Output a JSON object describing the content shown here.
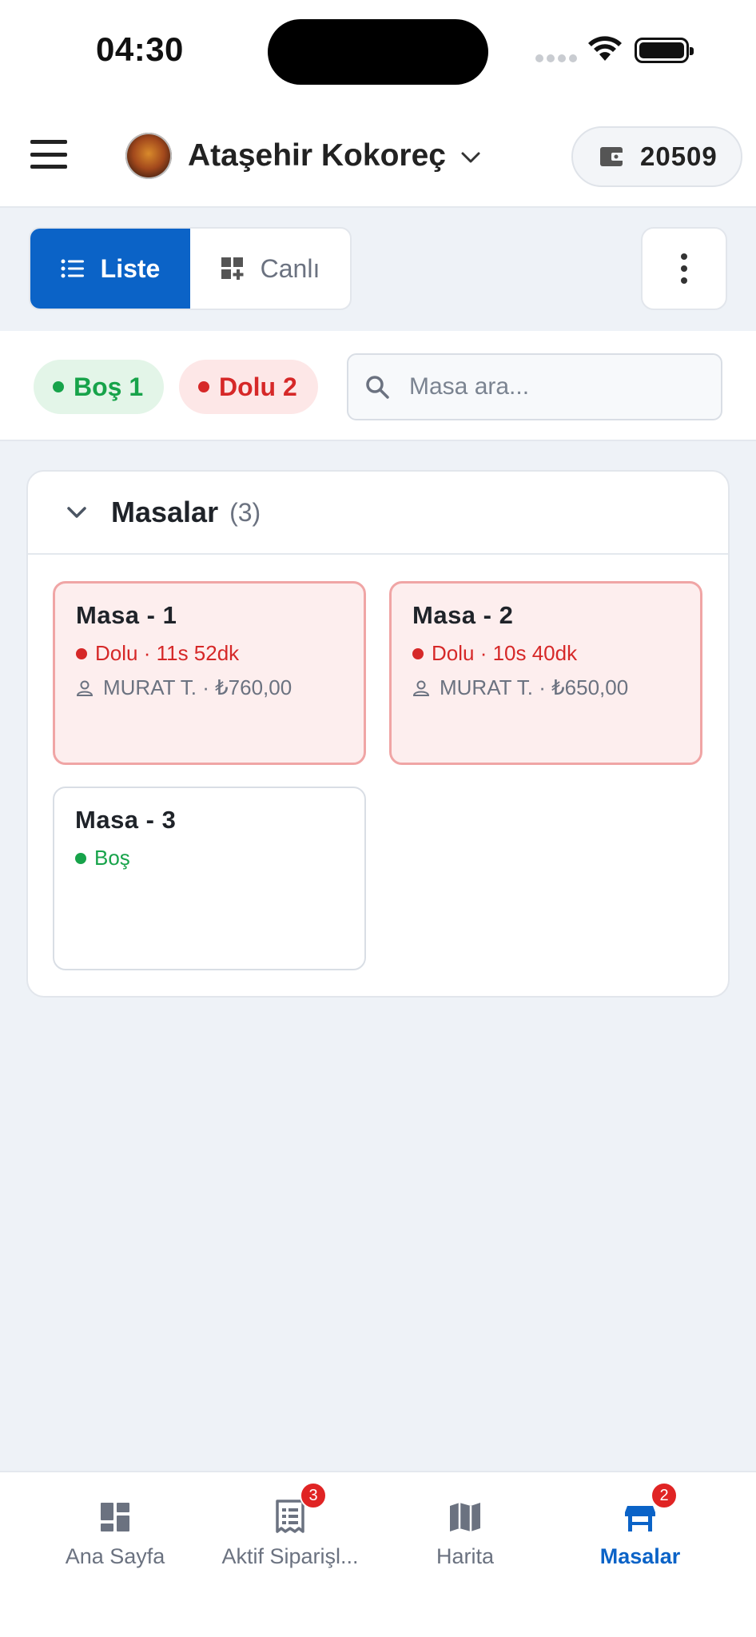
{
  "status_bar": {
    "time": "04:30",
    "icons": [
      "signal-icon",
      "wifi-icon",
      "battery-icon"
    ]
  },
  "header": {
    "business_name": "Ataşehir Kokoreç",
    "wallet_amount": "20509",
    "icons": [
      "menu-icon",
      "chevron-down-icon",
      "wallet-icon"
    ]
  },
  "view_toggle": {
    "list_label": "Liste",
    "live_label": "Canlı",
    "active": "list"
  },
  "filters": {
    "empty_chip": "Boş 1",
    "full_chip": "Dolu 2",
    "search_placeholder": "Masa ara..."
  },
  "section": {
    "title": "Masalar",
    "count": "(3)",
    "tables": [
      {
        "name": "Masa - 1",
        "status": "Dolu · 11s 52dk",
        "meta": "MURAT T. · ₺760,00",
        "state": "full"
      },
      {
        "name": "Masa - 2",
        "status": "Dolu · 10s 40dk",
        "meta": "MURAT T. · ₺650,00",
        "state": "full"
      },
      {
        "name": "Masa - 3",
        "status": "Boş",
        "state": "empty"
      }
    ]
  },
  "bottom_nav": {
    "items": [
      {
        "label": "Ana Sayfa",
        "icon": "dashboard-icon"
      },
      {
        "label": "Aktif Siparişl...",
        "icon": "receipt-icon",
        "badge": "3"
      },
      {
        "label": "Harita",
        "icon": "map-icon"
      },
      {
        "label": "Masalar",
        "icon": "table-icon",
        "badge": "2",
        "active": true
      }
    ]
  },
  "colors": {
    "primary": "#0b63c7",
    "danger": "#d62828",
    "success": "#17a34a",
    "background": "#eef2f7"
  }
}
